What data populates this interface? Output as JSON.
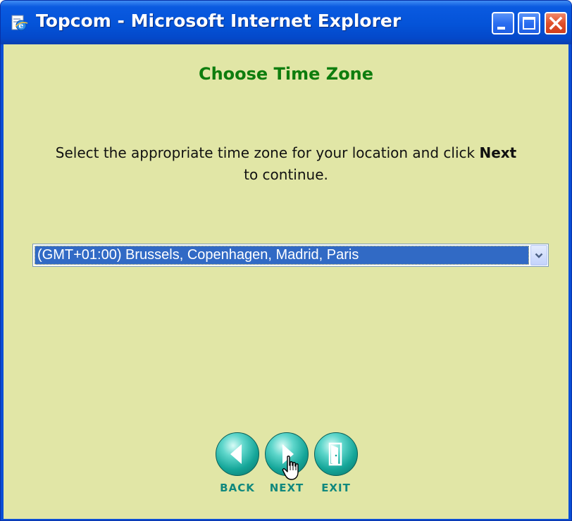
{
  "window": {
    "title": "Topcom - Microsoft Internet Explorer"
  },
  "page": {
    "heading": "Choose Time Zone",
    "instruction": {
      "before": "Select the appropriate time zone for your location and click ",
      "emphasis": "Next",
      "after": " to continue."
    },
    "timezone_select": {
      "selected": "(GMT+01:00) Brussels, Copenhagen, Madrid, Paris"
    },
    "nav": {
      "back_label": "BACK",
      "next_label": "NEXT",
      "exit_label": "EXIT"
    }
  },
  "colors": {
    "titlebar": "#0453d8",
    "page_background": "#e1e6a6",
    "heading": "#0e7d0e",
    "selection": "#316ac5",
    "nav_teal": "#14a598"
  },
  "icons": {
    "title": "ie-page-icon",
    "back": "arrow-left-icon",
    "next": "arrow-right-icon",
    "exit": "exit-door-icon",
    "dropdown": "chevron-down-icon",
    "cursor": "hand-pointer-icon"
  }
}
